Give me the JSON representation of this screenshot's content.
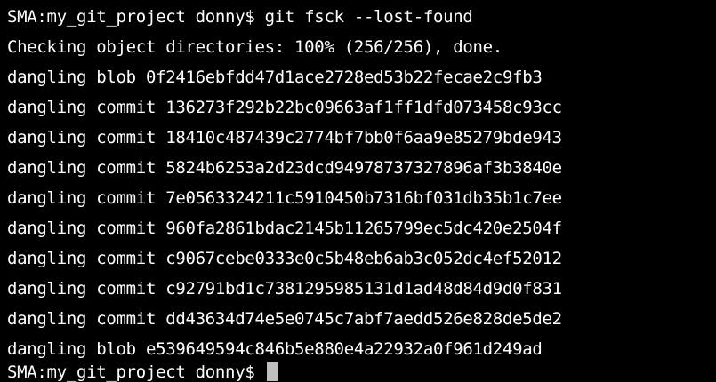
{
  "terminal": {
    "top_partial_line": "SMA:my_git_project donny$ git fsck --lost-found",
    "lines": [
      "SMA:my_git_project donny$ git fsck --lost-found",
      "Checking object directories: 100% (256/256), done.",
      "dangling blob 0f2416ebfdd47d1ace2728ed53b22fecae2c9fb3",
      "dangling commit 136273f292b22bc09663af1ff1dfd073458c93cc",
      "dangling commit 18410c487439c2774bf7bb0f6aa9e85279bde943",
      "dangling commit 5824b6253a2d23dcd94978737327896af3b3840e",
      "dangling commit 7e0563324211c5910450b7316bf031db35b1c7ee",
      "dangling commit 960fa2861bdac2145b11265799ec5dc420e2504f",
      "dangling commit c9067cebe0333e0c5b48eb6ab3c052dc4ef52012",
      "dangling commit c92791bd1c7381295985131d1ad48d84d9d0f831",
      "dangling commit dd43634d74e5e0745c7abf7aedd526e828de5de2",
      "dangling blob e539649594c846b5e880e4a22932a0f961d249ad"
    ],
    "prompt": "SMA:my_git_project donny$",
    "colors": {
      "background": "#000000",
      "text": "#ffffff",
      "cursor": "#bfbfbf"
    }
  }
}
